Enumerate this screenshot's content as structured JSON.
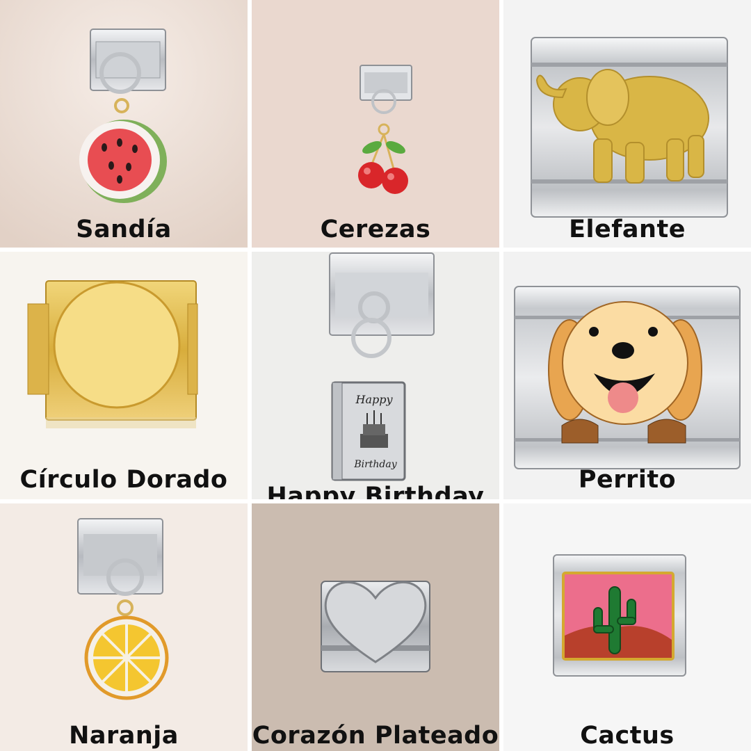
{
  "charms": [
    {
      "label": "Sandía"
    },
    {
      "label": "Cerezas"
    },
    {
      "label": "Elefante"
    },
    {
      "label": "Círculo Dorado"
    },
    {
      "label": "Happy Birthday"
    },
    {
      "label": "Perrito"
    },
    {
      "label": "Naranja"
    },
    {
      "label": "Corazón Plateado"
    },
    {
      "label": "Cactus"
    }
  ],
  "card_text": {
    "line1": "Happy",
    "line2": "Birthday"
  },
  "colors": {
    "silver": "#d9dbde",
    "gold": "#e2bf4e",
    "text": "#111111"
  }
}
